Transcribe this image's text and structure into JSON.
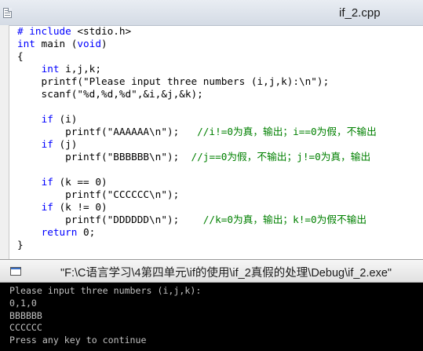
{
  "editor": {
    "title": "if_2.cpp",
    "code_lines": [
      [
        {
          "t": "# include ",
          "c": "kw"
        },
        {
          "t": "<stdio.h>",
          "c": ""
        }
      ],
      [
        {
          "t": "int",
          "c": "kw"
        },
        {
          "t": " main (",
          "c": ""
        },
        {
          "t": "void",
          "c": "kw"
        },
        {
          "t": ")",
          "c": ""
        }
      ],
      [
        {
          "t": "{",
          "c": ""
        }
      ],
      [
        {
          "t": "    ",
          "c": ""
        },
        {
          "t": "int",
          "c": "kw"
        },
        {
          "t": " i,j,k;",
          "c": ""
        }
      ],
      [
        {
          "t": "    printf(\"Please input three numbers (i,j,k):\\n\");",
          "c": ""
        }
      ],
      [
        {
          "t": "    scanf(\"%d,%d,%d\",&i,&j,&k);",
          "c": ""
        }
      ],
      [
        {
          "t": "",
          "c": ""
        }
      ],
      [
        {
          "t": "    ",
          "c": ""
        },
        {
          "t": "if",
          "c": "kw"
        },
        {
          "t": " (i)",
          "c": ""
        }
      ],
      [
        {
          "t": "        printf(\"AAAAAA\\n\");   ",
          "c": ""
        },
        {
          "t": "//i!=0为真，输出；i==0为假，不输出",
          "c": "cm"
        }
      ],
      [
        {
          "t": "    ",
          "c": ""
        },
        {
          "t": "if",
          "c": "kw"
        },
        {
          "t": " (j)",
          "c": ""
        }
      ],
      [
        {
          "t": "        printf(\"BBBBBB\\n\");  ",
          "c": ""
        },
        {
          "t": "//j==0为假，不输出；j!=0为真，输出",
          "c": "cm"
        }
      ],
      [
        {
          "t": "",
          "c": ""
        }
      ],
      [
        {
          "t": "    ",
          "c": ""
        },
        {
          "t": "if",
          "c": "kw"
        },
        {
          "t": " (k == 0)",
          "c": ""
        }
      ],
      [
        {
          "t": "        printf(\"CCCCCC\\n\");",
          "c": ""
        }
      ],
      [
        {
          "t": "    ",
          "c": ""
        },
        {
          "t": "if",
          "c": "kw"
        },
        {
          "t": " (k != 0)",
          "c": ""
        }
      ],
      [
        {
          "t": "        printf(\"DDDDDD\\n\");    ",
          "c": ""
        },
        {
          "t": "//k=0为真，输出；k!=0为假不输出",
          "c": "cm"
        }
      ],
      [
        {
          "t": "    ",
          "c": ""
        },
        {
          "t": "return",
          "c": "kw"
        },
        {
          "t": " 0;",
          "c": ""
        }
      ],
      [
        {
          "t": "}",
          "c": ""
        }
      ]
    ]
  },
  "console": {
    "title": "\"F:\\C语言学习\\4第四单元\\if的使用\\if_2真假的处理\\Debug\\if_2.exe\"",
    "lines": [
      "Please input three numbers (i,j,k):",
      "0,1,0",
      "BBBBBB",
      "CCCCCC",
      "Press any key to continue"
    ]
  },
  "icons": {
    "editor_icon": "document-icon",
    "console_icon": "console-window-icon"
  }
}
